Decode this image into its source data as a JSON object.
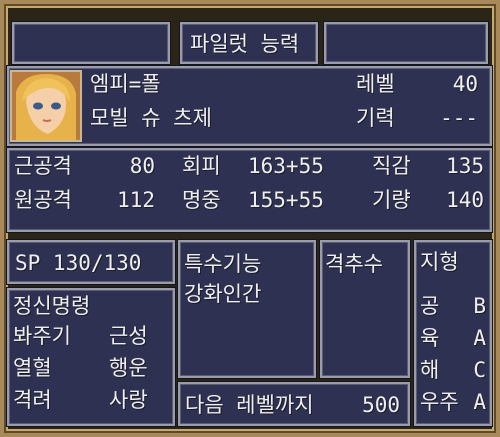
{
  "header": {
    "title": "파일럿 능력"
  },
  "pilot": {
    "name": "엠피=폴",
    "unit": "모빌 슈 츠제",
    "level_label": "레벨",
    "level_value": "40",
    "spirit_label": "기력",
    "spirit_value": "---",
    "portrait_icon": "pilot-portrait"
  },
  "stats": [
    {
      "label": "근공격",
      "value": "80"
    },
    {
      "label": "회피",
      "value": "163+55"
    },
    {
      "label": "직감",
      "value": "135"
    },
    {
      "label": "원공격",
      "value": "112"
    },
    {
      "label": "명중",
      "value": "155+55"
    },
    {
      "label": "기량",
      "value": "140"
    }
  ],
  "sp": {
    "text": "SP 130/130"
  },
  "special_skills": {
    "title": "특수기능",
    "items": [
      "강화인간"
    ]
  },
  "counter": {
    "title": "격추수"
  },
  "terrain": {
    "title": "지형",
    "rows": [
      {
        "label": "공",
        "grade": "B"
      },
      {
        "label": "육",
        "grade": "A"
      },
      {
        "label": "해",
        "grade": "C"
      },
      {
        "label": "우주",
        "grade": "A"
      }
    ]
  },
  "spirit_commands": {
    "title": "정신명령",
    "items": [
      [
        "봐주기",
        "근성"
      ],
      [
        "열혈",
        "행운"
      ],
      [
        "격려",
        "사랑"
      ]
    ]
  },
  "next_level": {
    "label": "다음 레벨까지",
    "value": "500"
  },
  "colors": {
    "panel": "#2e3152",
    "frame": "#a8895a",
    "text": "#efefef"
  }
}
